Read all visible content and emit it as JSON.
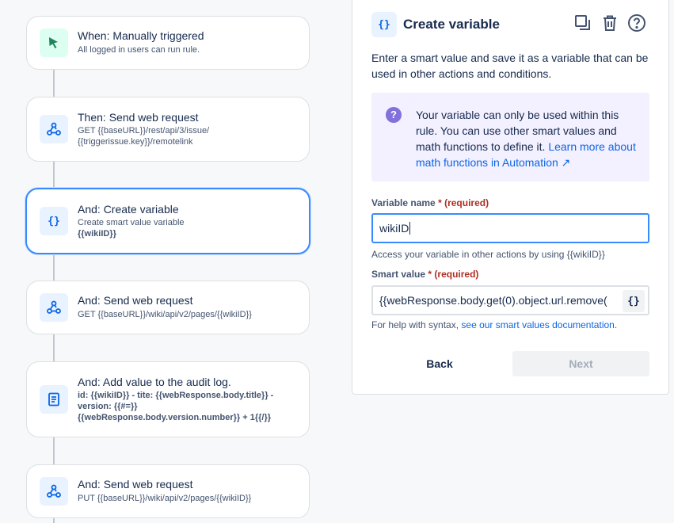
{
  "flow": {
    "cards": [
      {
        "title": "When: Manually triggered",
        "sub": "All logged in users can run rule."
      },
      {
        "title": "Then: Send web request",
        "sub1": "GET {{baseURL}}/rest/api/3/issue/",
        "sub2": "{{triggerissue.key}}/remotelink"
      },
      {
        "title": "And: Create variable",
        "sub1": "Create smart value variable",
        "sub2": "{{wikiID}}"
      },
      {
        "title": "And: Send web request",
        "sub": "GET {{baseURL}}/wiki/api/v2/pages/{{wikiID}}"
      },
      {
        "title": "And: Add value to the audit log.",
        "line1": "id: {{wikiID}} - tite: {{webResponse.body.title}} -",
        "line2": "version: {{#=}}",
        "line3": "{{webResponse.body.version.number}} + 1{{/}}"
      },
      {
        "title": "And: Send web request",
        "sub": "PUT {{baseURL}}/wiki/api/v2/pages/{{wikiID}}"
      }
    ]
  },
  "panel": {
    "title": "Create variable",
    "description": "Enter a smart value and save it as a variable that can be used in other actions and conditions.",
    "note_text": "Your variable can only be used within this rule. You can use other smart values and math functions to define it. ",
    "note_link": "Learn more about math functions in Automation ↗",
    "variable_name_label": "Variable name",
    "required_mark": "*",
    "required_text": "(required)",
    "variable_name_value": "wikiID",
    "variable_help": "Access your variable in other actions by using {{wikiID}}",
    "smart_value_label": "Smart value",
    "smart_value_value": "{{webResponse.body.get(0).object.url.remove(",
    "smart_help_text": "For help with syntax, ",
    "smart_help_link": "see our smart values documentation",
    "smart_help_end": ".",
    "back_label": "Back",
    "next_label": "Next",
    "brace_label": "{}",
    "head_icon": "{}"
  },
  "icons": [
    "cursor-icon",
    "webhook-icon",
    "braces-icon",
    "document-icon",
    "duplicate-icon",
    "trash-icon",
    "help-icon"
  ],
  "colors": {
    "accent": "#0c66e4",
    "focus": "#388bff",
    "note_bg": "#f3f0ff",
    "required": "#ae2e24"
  }
}
